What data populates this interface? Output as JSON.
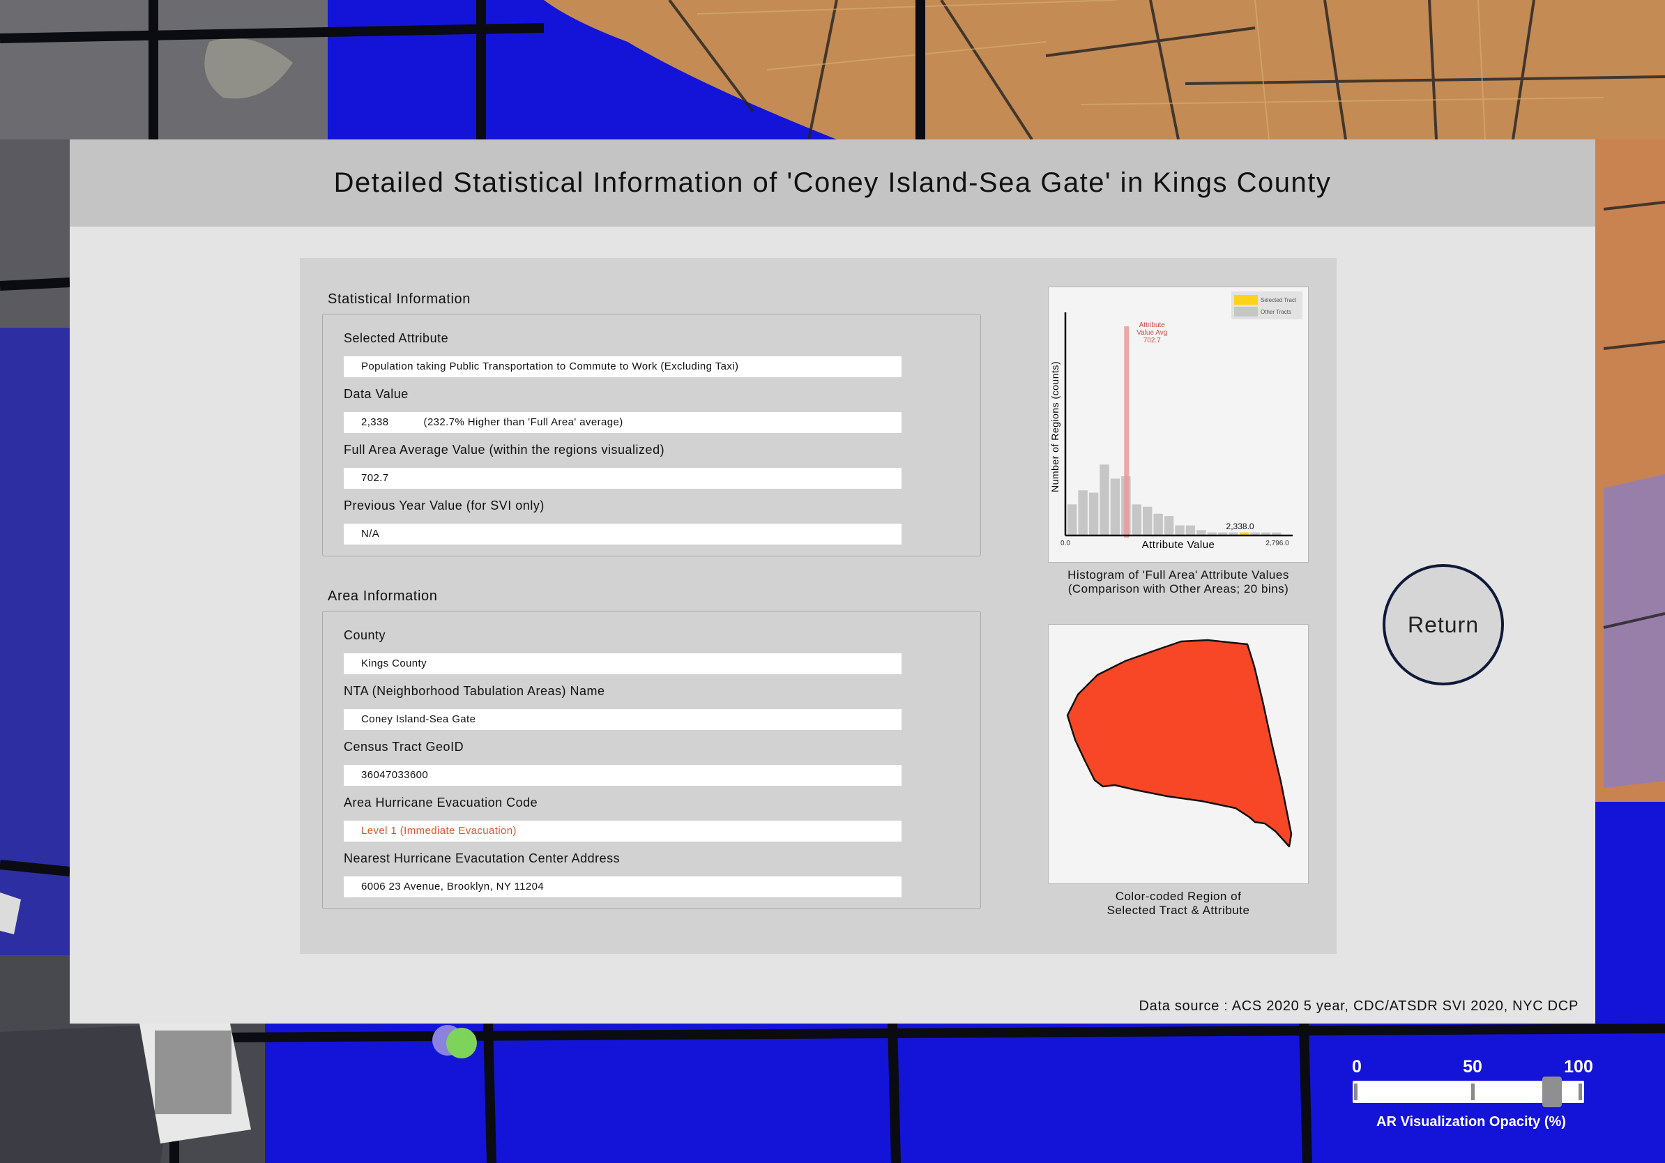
{
  "title": "Detailed Statistical Information of 'Coney Island-Sea Gate' in Kings County",
  "statistical": {
    "heading": "Statistical Information",
    "fields": [
      {
        "label": "Selected Attribute",
        "value": "Population taking Public Transportation to Commute to Work (Excluding Taxi)"
      },
      {
        "label": "Data Value",
        "value": "2,338",
        "extra": "(232.7% Higher than 'Full Area' average)"
      },
      {
        "label": "Full Area Average Value (within the regions visualized)",
        "value": "702.7"
      },
      {
        "label": "Previous Year Value (for SVI only)",
        "value": "N/A"
      }
    ]
  },
  "area": {
    "heading": "Area Information",
    "fields": [
      {
        "label": "County",
        "value": "Kings County"
      },
      {
        "label": "NTA (Neighborhood Tabulation Areas) Name",
        "value": "Coney Island-Sea Gate"
      },
      {
        "label": "Census Tract GeoID",
        "value": "36047033600"
      },
      {
        "label": "Area Hurricane Evacuation Code",
        "value": "Level 1 (Immediate Evacuation)"
      },
      {
        "label": "Nearest Hurricane Evacutation Center Address",
        "value": "6006 23 Avenue, Brooklyn, NY 11204"
      }
    ]
  },
  "histogram": {
    "caption_line1": "Histogram of 'Full Area' Attribute Values",
    "caption_line2": "(Comparison with Other Areas; 20 bins)"
  },
  "region": {
    "caption_line1": "Color-coded Region of",
    "caption_line2": "Selected Tract & Attribute",
    "fill_color": "#f84726"
  },
  "chart_data": {
    "type": "bar",
    "xlabel": "Attribute Value",
    "ylabel": "Number of Regions (counts)",
    "xlim": [
      0.0,
      2796.0
    ],
    "x_tick_labels": [
      "0.0",
      "2,796.0"
    ],
    "bins": 20,
    "counts": [
      13,
      19,
      18,
      30,
      24,
      25,
      13,
      12,
      9,
      8,
      4,
      4,
      2,
      1,
      1,
      1,
      1,
      1,
      1,
      1
    ],
    "ylim": [
      0,
      95
    ],
    "selected_bin": 16,
    "selected_value_label": "2,338.0",
    "average": {
      "value": 702.7,
      "label": "Attribute Value Avg",
      "value_label": "702.7"
    },
    "legend": [
      {
        "name": "Selected Tract",
        "color": "#ffd21a"
      },
      {
        "name": "Other Tracts",
        "color": "#c6c6c6"
      }
    ],
    "colors": {
      "bar": "#c6c6c6",
      "avg_line": "#e79a9a",
      "avg_text": "#d0504c"
    }
  },
  "return_label": "Return",
  "data_source": "Data source : ACS 2020 5 year, CDC/ATSDR SVI 2020, NYC DCP",
  "slider": {
    "ticks": [
      "0",
      "50",
      "100"
    ],
    "value": 88,
    "label": "AR Visualization Opacity (%)"
  }
}
